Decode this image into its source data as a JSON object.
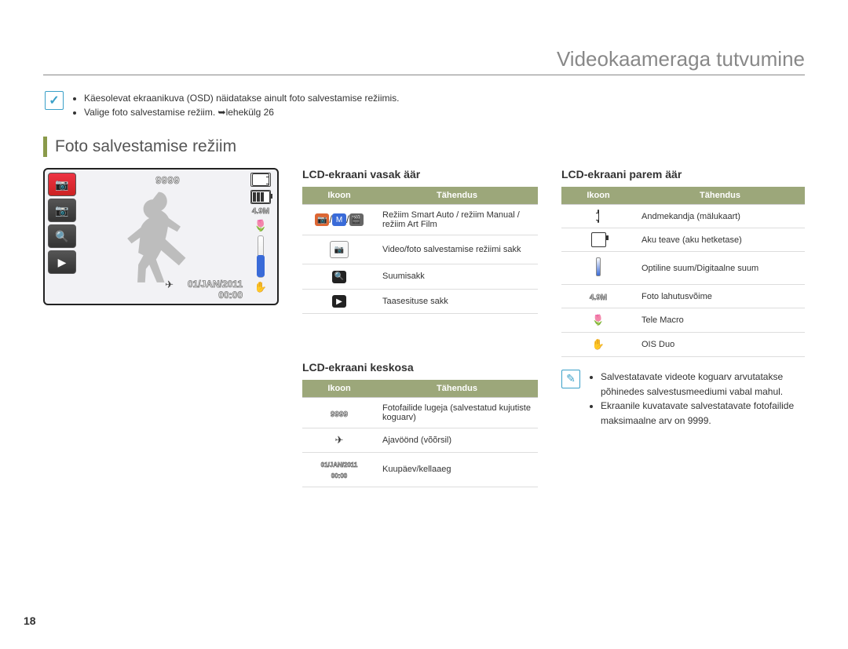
{
  "chapterTitle": "Videokaameraga tutvumine",
  "topNotes": [
    "Käesolevat ekraanikuva (OSD) näidatakse ainult foto salvestamise režiimis.",
    "Valige foto salvestamise režiim. ➥lehekülg 26"
  ],
  "sectionTitle": "Foto salvestamise režiim",
  "lcd": {
    "counter": "9999",
    "resolution": "4.9M",
    "date": "01/JAN/2011",
    "time": "00:00"
  },
  "leftTable": {
    "heading": "LCD-ekraani vasak äär",
    "headers": {
      "icon": "Ikoon",
      "meaning": "Tähendus"
    },
    "rows": [
      {
        "iconKey": "mode-triple",
        "meaning": "Režiim Smart Auto / režiim Manual / režiim Art Film"
      },
      {
        "iconKey": "rec-tab",
        "meaning": "Video/foto salvestamise režiimi sakk"
      },
      {
        "iconKey": "zoom-tab",
        "meaning": "Suumisakk"
      },
      {
        "iconKey": "play-tab",
        "meaning": "Taasesituse sakk"
      }
    ]
  },
  "centerTable": {
    "heading": "LCD-ekraani keskosa",
    "headers": {
      "icon": "Ikoon",
      "meaning": "Tähendus"
    },
    "rows": [
      {
        "iconKey": "counter",
        "iconText": "9999",
        "meaning": "Fotofailide lugeja (salvestatud kujutiste koguarv)"
      },
      {
        "iconKey": "timezone",
        "meaning": "Ajavöönd (võõrsil)"
      },
      {
        "iconKey": "datetime",
        "iconText1": "01/JAN/2011",
        "iconText2": "00:00",
        "meaning": "Kuupäev/kellaaeg"
      }
    ]
  },
  "rightTable": {
    "heading": "LCD-ekraani parem äär",
    "headers": {
      "icon": "Ikoon",
      "meaning": "Tähendus"
    },
    "rows": [
      {
        "iconKey": "card",
        "meaning": "Andmekandja (mälukaart)"
      },
      {
        "iconKey": "battery",
        "meaning": "Aku teave (aku hetketase)"
      },
      {
        "iconKey": "zoombar",
        "meaning": "Optiline suum/Digitaalne suum"
      },
      {
        "iconKey": "res",
        "iconText": "4.9M",
        "meaning": "Foto lahutusvõime"
      },
      {
        "iconKey": "macro",
        "meaning": "Tele Macro"
      },
      {
        "iconKey": "ois",
        "meaning": "OIS Duo"
      }
    ]
  },
  "bottomNotes": [
    "Salvestatavate videote koguarv arvutatakse põhinedes salvestusmeediumi vabal mahul.",
    "Ekraanile kuvatavate salvestatavate fotofailide maksimaalne arv on 9999."
  ],
  "pageNumber": "18"
}
